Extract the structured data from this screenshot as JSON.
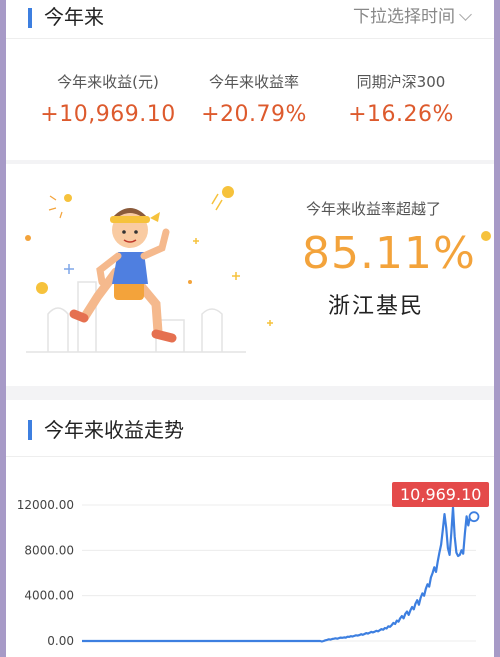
{
  "header": {
    "title": "今年来",
    "period_selector": "下拉选择时间"
  },
  "summary": {
    "items": [
      {
        "label": "今年来收益(元)",
        "value": "+10,969.10"
      },
      {
        "label": "今年来收益率",
        "value": "+20.79%"
      },
      {
        "label": "同期沪深300",
        "value": "+16.26%"
      }
    ]
  },
  "ranking": {
    "label": "今年来收益率超越了",
    "value": "85.11%",
    "region": "浙江基民"
  },
  "trend": {
    "title": "今年来收益走势",
    "current_badge": "10,969.10"
  },
  "colors": {
    "accent": "#3d7fe0",
    "gain": "#dd5a2d",
    "highlight": "#f3a33b",
    "badge": "#e44a4a",
    "line": "#3d7fe0"
  },
  "chart_data": {
    "type": "line",
    "ylim": [
      0,
      12000
    ],
    "yticks": [
      "0.00",
      "4000.00",
      "8000.00",
      "12000.00"
    ],
    "ytick_values": [
      0,
      4000,
      8000,
      12000
    ],
    "xlabel": "",
    "ylabel": "",
    "series": [
      {
        "values": [
          0,
          0,
          0,
          0,
          0,
          0,
          0,
          0,
          0,
          0,
          0,
          0,
          0,
          0,
          0,
          0,
          0,
          0,
          0,
          0,
          0,
          0,
          0,
          0,
          0,
          0,
          0,
          0,
          0,
          0,
          0,
          0,
          0,
          0,
          0,
          0,
          0,
          0,
          0,
          0,
          0,
          0,
          0,
          0,
          0,
          0,
          0,
          0,
          0,
          0,
          0,
          0,
          0,
          0,
          0,
          0,
          0,
          0,
          0,
          0,
          0,
          0,
          0,
          0,
          0,
          0,
          0,
          0,
          0,
          0,
          0,
          0,
          0,
          0,
          0,
          0,
          0,
          0,
          0,
          0,
          0,
          0,
          0,
          0,
          0,
          0,
          0,
          0,
          0,
          0,
          0,
          0,
          0,
          0,
          0,
          0,
          0,
          0,
          0,
          0,
          0,
          0,
          0,
          0,
          0,
          0,
          0,
          0,
          0,
          0,
          0,
          0,
          0,
          0,
          0,
          0,
          0,
          0,
          0,
          0,
          0,
          0,
          0,
          0,
          0,
          0,
          0,
          0,
          0,
          0,
          0,
          0,
          0,
          0,
          0,
          0,
          0,
          0,
          0,
          0,
          0,
          -40,
          0,
          60,
          100,
          150,
          120,
          180,
          200,
          240,
          200,
          260,
          300,
          280,
          320,
          300,
          380,
          360,
          420,
          400,
          450,
          500,
          480,
          520,
          600,
          550,
          620,
          700,
          650,
          720,
          800,
          760,
          820,
          900,
          850,
          950,
          1050,
          1000,
          1150,
          1100,
          1300,
          1250,
          1400,
          1600,
          1500,
          1800,
          1700,
          2000,
          2200,
          2000,
          2400,
          2600,
          2300,
          2700,
          3000,
          2800,
          3300,
          3600,
          3200,
          3800,
          4200,
          4000,
          4600,
          5000,
          4800,
          5600,
          6000,
          6500,
          6100,
          7000,
          7800,
          8500,
          9800,
          11200,
          10000,
          8200,
          7600,
          9500,
          11800,
          9200,
          7800,
          7500,
          7600,
          8000,
          7700,
          9500,
          11000,
          10200,
          10969
        ],
        "marker_last": true
      }
    ]
  }
}
